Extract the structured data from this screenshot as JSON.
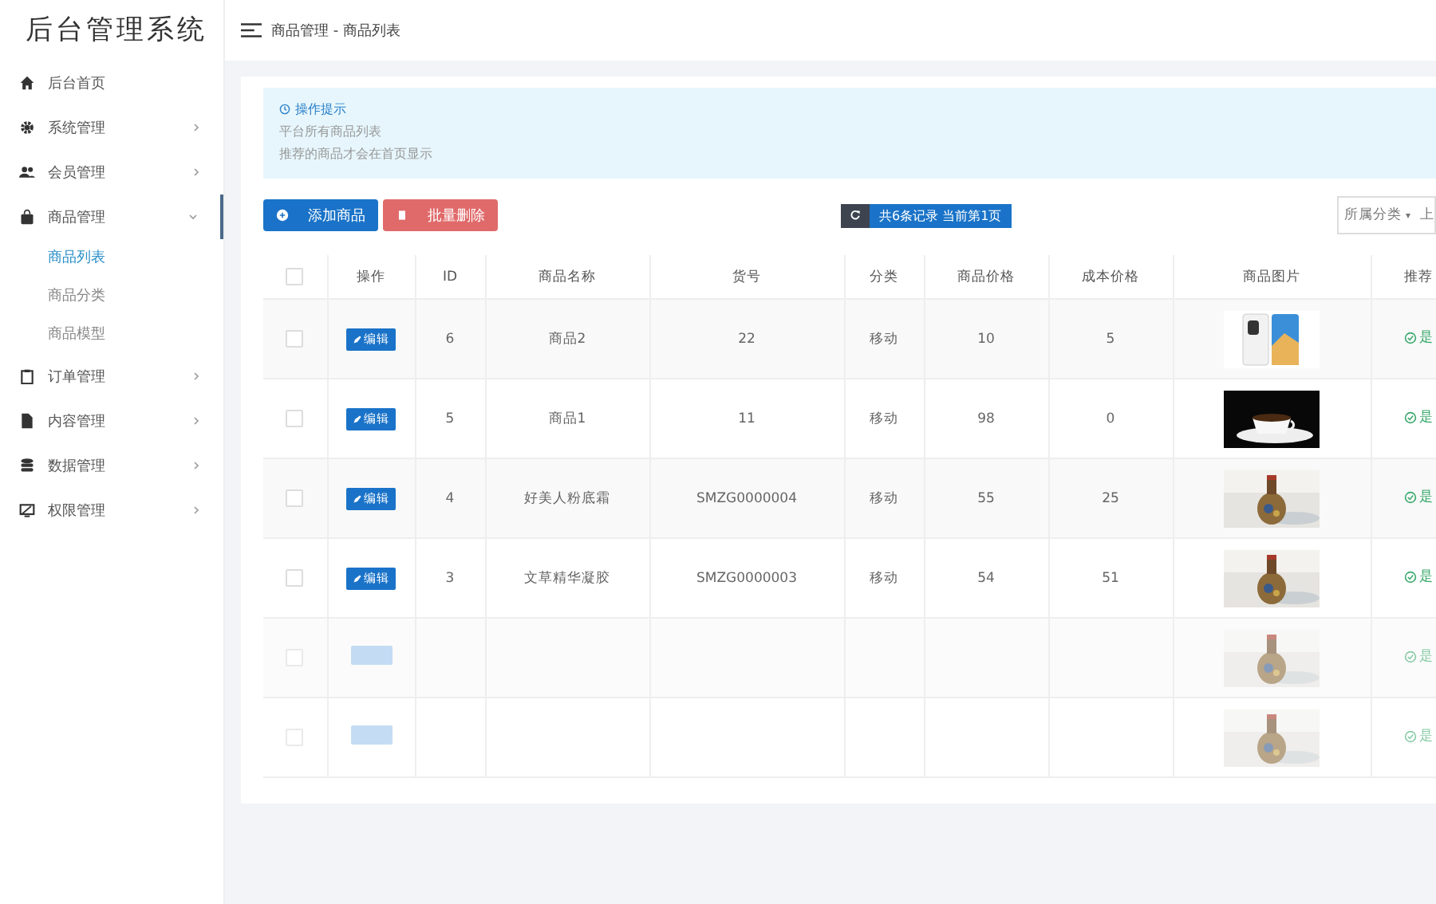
{
  "logo": "后台管理系统",
  "breadcrumb": "商品管理 - 商品列表",
  "sidebar": {
    "items": [
      {
        "label": "后台首页",
        "expanded": false,
        "has_arrow": false
      },
      {
        "label": "系统管理",
        "expanded": false,
        "has_arrow": true
      },
      {
        "label": "会员管理",
        "expanded": false,
        "has_arrow": true
      },
      {
        "label": "商品管理",
        "expanded": true,
        "has_arrow": true,
        "children": [
          {
            "label": "商品列表",
            "selected": true
          },
          {
            "label": "商品分类",
            "selected": false
          },
          {
            "label": "商品模型",
            "selected": false
          }
        ]
      },
      {
        "label": "订单管理",
        "expanded": false,
        "has_arrow": true
      },
      {
        "label": "内容管理",
        "expanded": false,
        "has_arrow": true
      },
      {
        "label": "数据管理",
        "expanded": false,
        "has_arrow": true
      },
      {
        "label": "权限管理",
        "expanded": false,
        "has_arrow": true
      }
    ]
  },
  "tip": {
    "title": "操作提示",
    "lines": [
      "平台所有商品列表",
      "推荐的商品才会在首页显示"
    ]
  },
  "toolbar": {
    "add_button": "添加商品",
    "delete_button": "批量删除",
    "record_info": "共6条记录 当前第1页",
    "category_select": "所属分类",
    "category_caret": "▾",
    "cut_text": "上"
  },
  "table": {
    "select_all_checked": false,
    "columns": [
      "操作",
      "ID",
      "商品名称",
      "货号",
      "分类",
      "商品价格",
      "成本价格",
      "商品图片",
      "推荐"
    ],
    "rows": [
      {
        "checked": false,
        "edit": "编辑",
        "id": "6",
        "name": "商品2",
        "sku": "22",
        "category": "移动",
        "price": "10",
        "cost": "5",
        "recommend": "是"
      },
      {
        "checked": false,
        "edit": "编辑",
        "id": "5",
        "name": "商品1",
        "sku": "11",
        "category": "移动",
        "price": "98",
        "cost": "0",
        "recommend": "是"
      },
      {
        "checked": false,
        "edit": "编辑",
        "id": "4",
        "name": "好美人粉底霜",
        "sku": "SMZG0000004",
        "category": "移动",
        "price": "55",
        "cost": "25",
        "recommend": "是"
      },
      {
        "checked": false,
        "edit": "编辑",
        "id": "3",
        "name": "文草精华凝胶",
        "sku": "SMZG0000003",
        "category": "移动",
        "price": "54",
        "cost": "51",
        "recommend": "是"
      },
      {
        "checked": false,
        "recommend": "是"
      },
      {
        "checked": false,
        "recommend": "是"
      }
    ]
  }
}
